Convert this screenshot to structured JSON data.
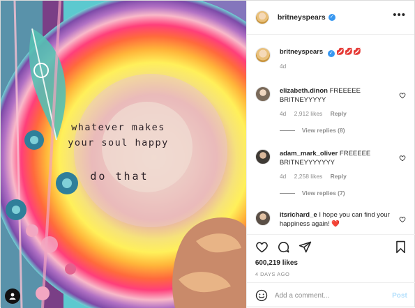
{
  "post": {
    "username": "britneyspears",
    "verified_icon": "verified-badge-icon",
    "more_icon": "more-options-icon"
  },
  "media": {
    "quote_line1": "whatever makes",
    "quote_line2": "your soul happy",
    "quote_line3": "do that",
    "tag_icon": "user-tag-icon"
  },
  "caption": {
    "username": "britneyspears",
    "emoji": "💋💋💋",
    "time": "4d"
  },
  "comments": [
    {
      "username": "elizabeth.dinon",
      "text": "FREEEEE BRITNEYYYYY",
      "time": "4d",
      "likes": "2,912 likes",
      "reply_label": "Reply",
      "view_replies": "View replies (8)"
    },
    {
      "username": "adam_mark_oliver",
      "text": "FREEEEE BRITNEYYYYYYY",
      "time": "4d",
      "likes": "2,258 likes",
      "reply_label": "Reply",
      "view_replies": "View replies (7)"
    },
    {
      "username": "itsrichard_e",
      "text": "I hope you can find your happiness again! ❤️"
    }
  ],
  "actions": {
    "like_icon": "heart-icon",
    "comment_icon": "comment-icon",
    "share_icon": "share-icon",
    "save_icon": "bookmark-icon",
    "likes_count": "600,219 likes",
    "posted_ago": "4 DAYS AGO"
  },
  "add_comment": {
    "placeholder": "Add a comment...",
    "post_label": "Post",
    "emoji_icon": "emoji-icon"
  },
  "colors": {
    "verified": "#3897f0",
    "link_disabled": "#b2dffc",
    "secondary_text": "#8e8e8e",
    "heart_red": "#ed4956"
  }
}
